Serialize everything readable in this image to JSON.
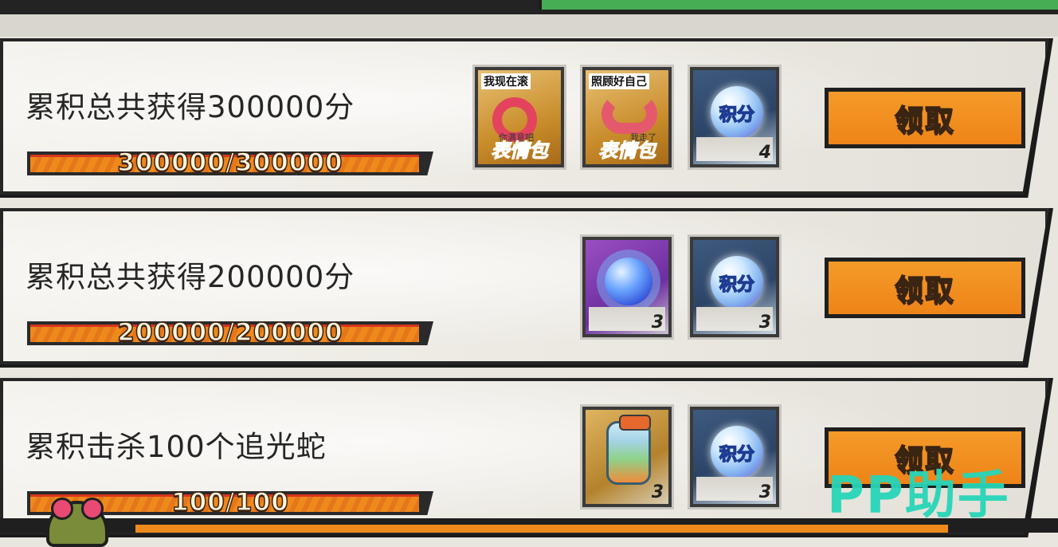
{
  "rewards": [
    {
      "title": "累积总共获得300000分",
      "progress_text": "300000/300000",
      "progress": 1.0,
      "button": "领取",
      "items": [
        {
          "type": "meme-pack",
          "caption": "我现在滚",
          "sub": "你满意吧",
          "label": "表情包"
        },
        {
          "type": "meme-pack",
          "caption": "照顾好自己",
          "sub": "我走了",
          "label": "表情包"
        },
        {
          "type": "points-orb",
          "orb_text": "积分",
          "count": "4"
        }
      ]
    },
    {
      "title": "累积总共获得200000分",
      "progress_text": "200000/200000",
      "progress": 1.0,
      "button": "领取",
      "items": [
        {
          "type": "blue-gem",
          "count": "3"
        },
        {
          "type": "points-orb",
          "orb_text": "积分",
          "count": "3"
        }
      ]
    },
    {
      "title": "累积击杀100个追光蛇",
      "progress_text": "100/100",
      "progress": 1.0,
      "button": "领取",
      "items": [
        {
          "type": "candy-jar",
          "count": "3"
        },
        {
          "type": "points-orb",
          "orb_text": "积分",
          "count": "3"
        }
      ]
    }
  ],
  "watermark": "PP助手"
}
